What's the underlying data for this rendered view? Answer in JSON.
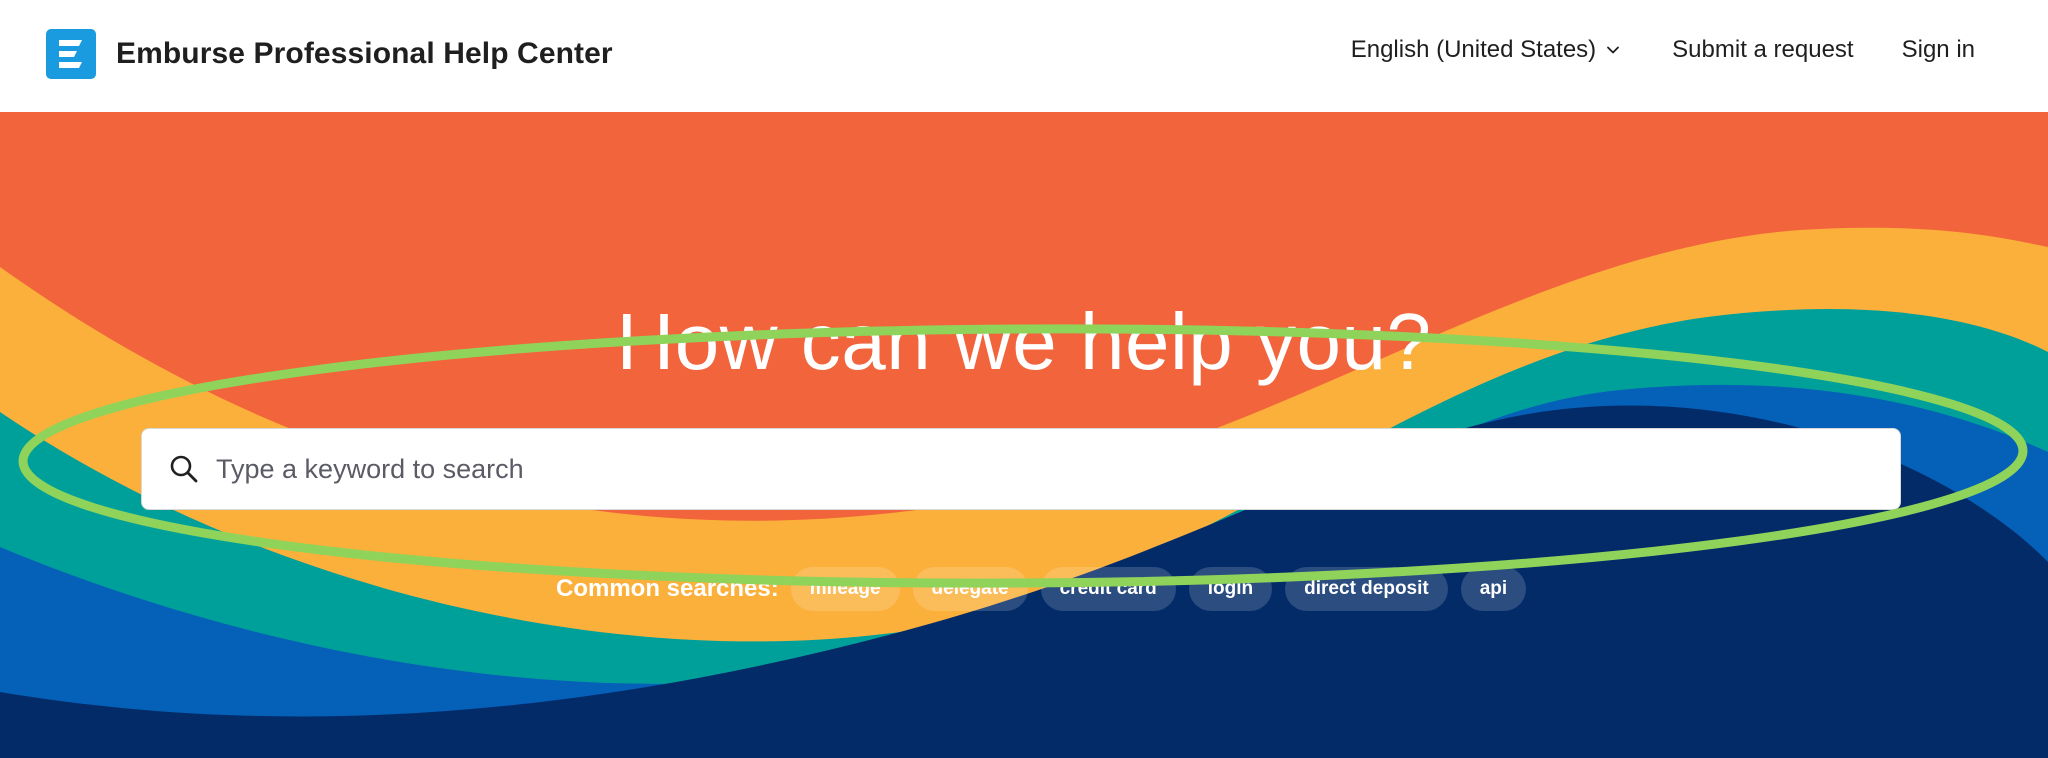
{
  "header": {
    "brand_name": "Emburse Professional Help Center",
    "language_selector": "English (United States)",
    "submit_request": "Submit a request",
    "sign_in": "Sign in"
  },
  "hero": {
    "title": "How can we help you?",
    "search_placeholder": "Type a keyword to search",
    "common_searches_label": "Common searches:",
    "common_searches": [
      "mileage",
      "delegate",
      "credit card",
      "login",
      "direct deposit",
      "api"
    ]
  },
  "icons": {
    "brand_logo": "emburse-logo-icon",
    "language_chevron": "chevron-down-icon",
    "search": "search-icon"
  },
  "colors": {
    "brand_blue": "#1a9be0",
    "hero_orange": "#f2643b",
    "hero_yellow": "#fbb03b",
    "hero_teal": "#00a09a",
    "hero_blue": "#0560b8",
    "hero_navy": "#032b68",
    "highlight_green": "#8fd35a"
  }
}
